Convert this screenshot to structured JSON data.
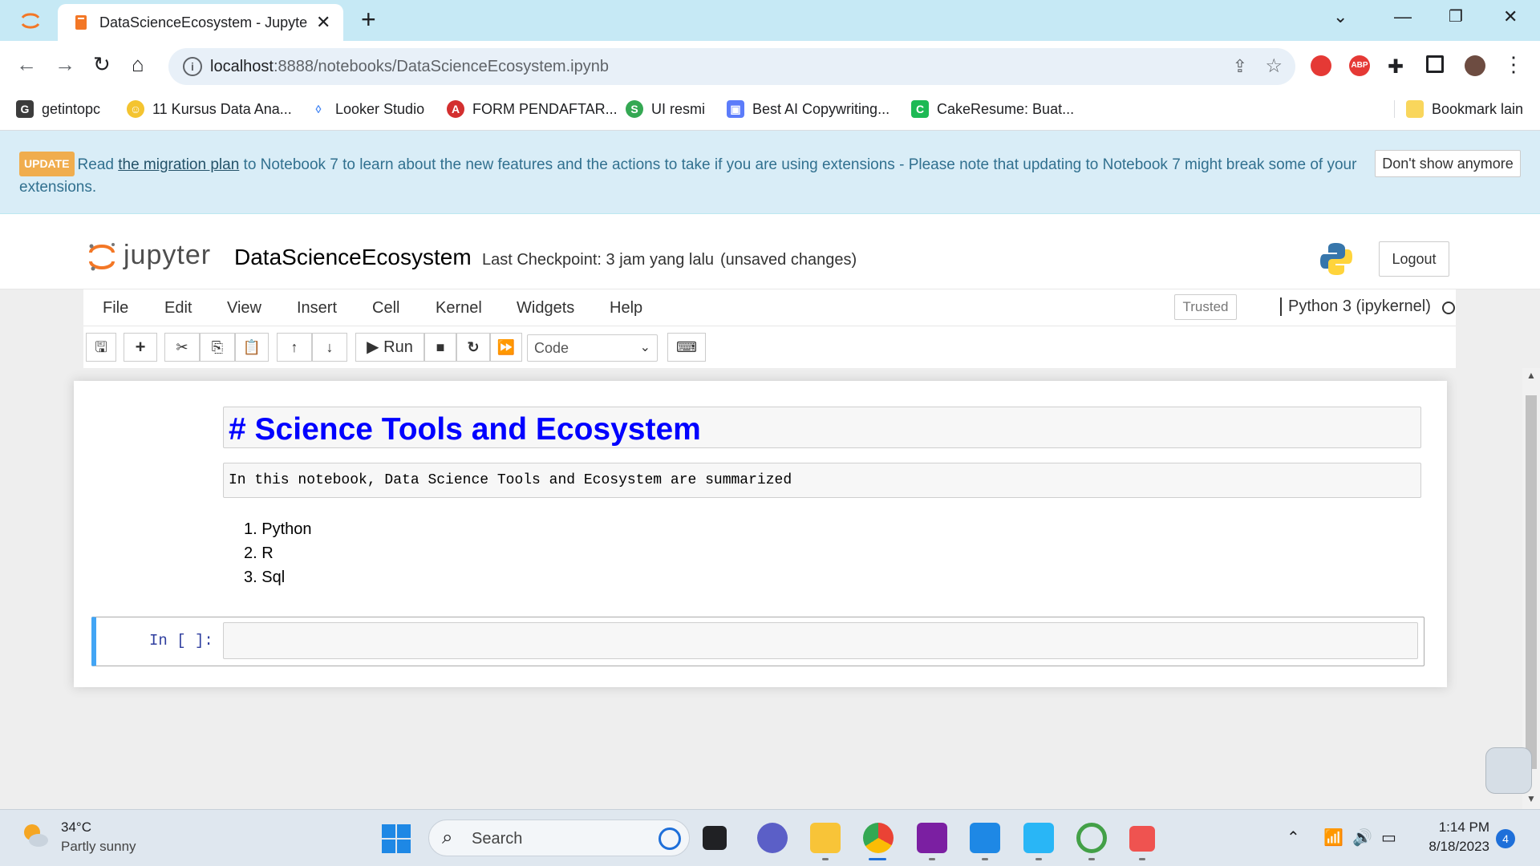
{
  "browser": {
    "tab_title": "DataScienceEcosystem - Jupyter N",
    "url_host": "localhost",
    "url_rest": ":8888/notebooks/DataScienceEcosystem.ipynb",
    "bookmarks": [
      {
        "label": "getintopc",
        "color": "#3c3c3c",
        "glyph": "G"
      },
      {
        "label": "11 Kursus Data Ana...",
        "color": "#f4c430",
        "glyph": "☺"
      },
      {
        "label": "Looker Studio",
        "color": "#4285f4",
        "glyph": "◊"
      },
      {
        "label": "FORM PENDAFTAR...",
        "color": "#d32f2f",
        "glyph": "A"
      },
      {
        "label": "UI resmi",
        "color": "#34a853",
        "glyph": "S"
      },
      {
        "label": "Best AI Copywriting...",
        "color": "#5c7cfa",
        "glyph": "▣"
      },
      {
        "label": "CakeResume: Buat...",
        "color": "#1db954",
        "glyph": "C"
      }
    ],
    "other_bookmarks": "Bookmark lain"
  },
  "banner": {
    "badge": "UPDATE",
    "text_before": "Read ",
    "link": "the migration plan",
    "text_after": " to Notebook 7 to learn about the new features and the actions to take if you are using extensions - Please note that updating to Notebook 7 might break some of your extensions.",
    "dismiss": "Don't show anymore"
  },
  "header": {
    "logo_text": "jupyter",
    "notebook_name": "DataScienceEcosystem",
    "checkpoint": "Last Checkpoint: 3 jam yang lalu",
    "unsaved": "(unsaved changes)",
    "logout": "Logout"
  },
  "menubar": {
    "items": [
      "File",
      "Edit",
      "View",
      "Insert",
      "Cell",
      "Kernel",
      "Widgets",
      "Help"
    ],
    "trusted": "Trusted",
    "kernel": "Python 3 (ipykernel)"
  },
  "toolbar": {
    "run_label": "Run",
    "cell_type": "Code"
  },
  "notebook": {
    "heading_cell": "# Science Tools and Ecosystem",
    "raw_cell": "In this notebook, Data Science Tools and Ecosystem are summarized",
    "list": [
      "1. Python",
      "2. R",
      "3. Sql"
    ],
    "code_prompt": "In [ ]:"
  },
  "taskbar": {
    "temperature": "34°C",
    "condition": "Partly sunny",
    "search": "Search",
    "time": "1:14 PM",
    "date": "8/18/2023",
    "notifications": "4"
  }
}
